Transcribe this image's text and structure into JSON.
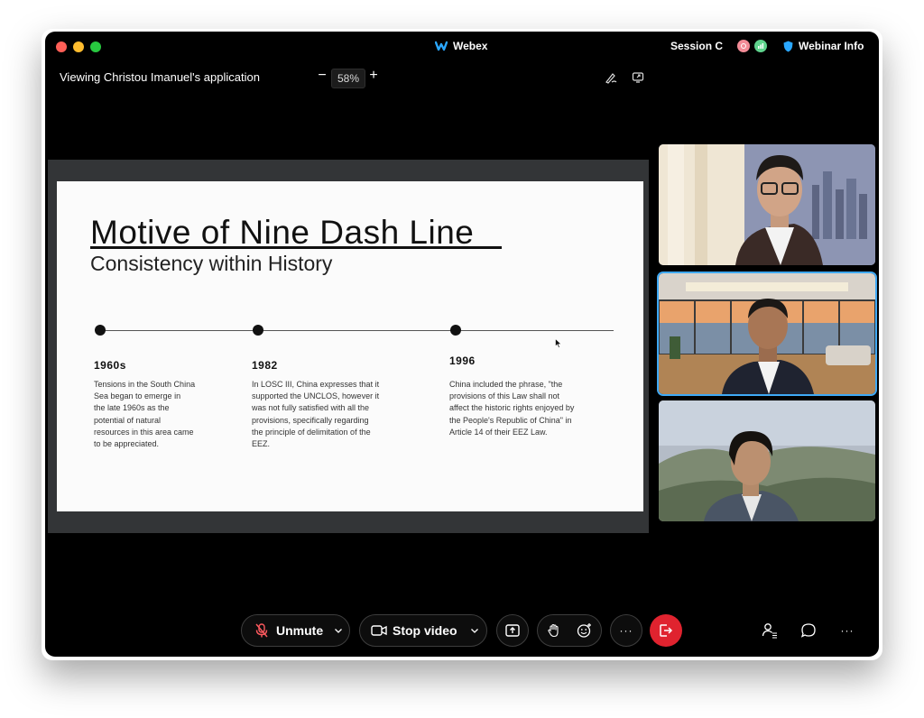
{
  "titlebar": {
    "app_name": "Webex",
    "session_label": "Session C",
    "webinar_info_label": "Webinar Info"
  },
  "share_toolbar": {
    "viewing_label": "Viewing Christou Imanuel's application",
    "zoom_level": "58%",
    "zoom_out": "−",
    "zoom_in": "+"
  },
  "slide": {
    "title": "Motive of Nine Dash Line",
    "subtitle": "Consistency within History",
    "timeline": [
      {
        "year": "1960s",
        "lines": [
          "Tensions in the South China",
          "Sea began to emerge in",
          "the late 1960s as the",
          "potential of natural",
          "resources in this area came",
          "to be appreciated."
        ]
      },
      {
        "year": "1982",
        "lines": [
          "In LOSC III, China expresses that it",
          "supported the UNCLOS, however it",
          "was not fully satisfied with all the",
          "provisions, specifically regarding",
          "the principle of delimitation of the",
          "EEZ."
        ]
      },
      {
        "year": "1996",
        "lines": [
          "China included the phrase, \"the",
          "provisions of this Law shall not",
          "affect the historic rights enjoyed by",
          "the People's Republic of China\" in",
          "Article 14 of their EEZ Law."
        ]
      }
    ]
  },
  "controls": {
    "unmute_label": "Unmute",
    "stop_video_label": "Stop video",
    "more_label": "···"
  },
  "colors": {
    "leave_button": "#e0232f",
    "active_speaker_border": "#3fa9f5",
    "window_background": "#000000"
  },
  "icons": [
    "webex-logo-icon",
    "shield-icon",
    "annotate-icon",
    "pop-out-icon",
    "mic-muted-icon",
    "video-camera-icon",
    "chevron-down-icon",
    "share-icon",
    "raise-hand-icon",
    "reactions-icon",
    "more-icon",
    "leave-icon",
    "participants-icon",
    "chat-icon"
  ]
}
